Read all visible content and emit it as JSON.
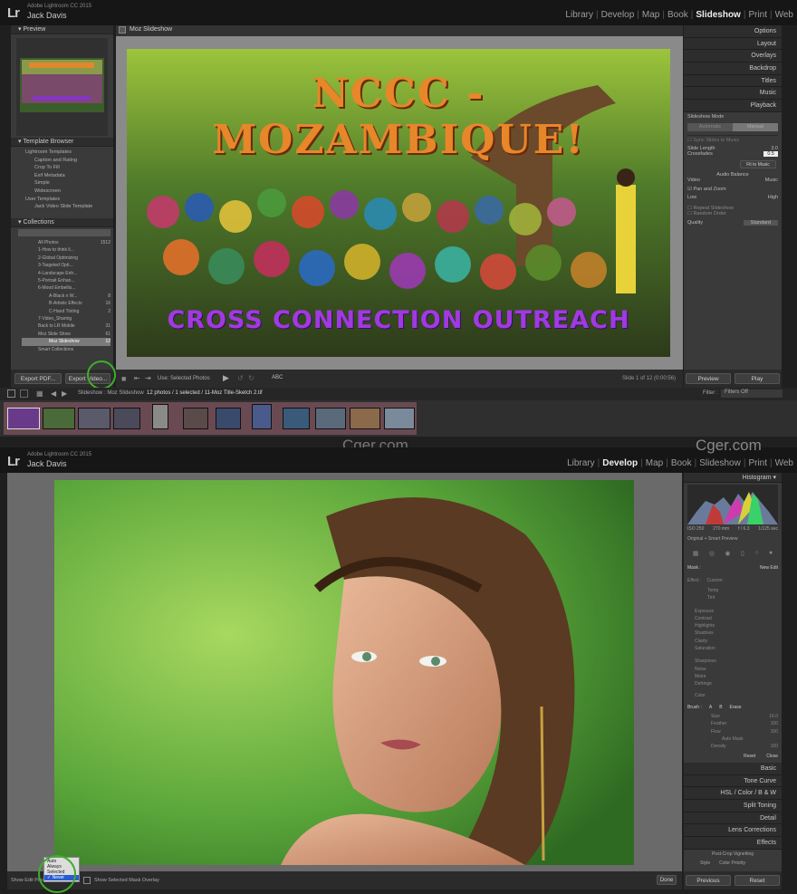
{
  "top": {
    "logo": "Lr",
    "product": "Adobe Lightroom CC 2015",
    "user": "Jack Davis",
    "modules": [
      "Library",
      "Develop",
      "Map",
      "Book",
      "Slideshow",
      "Print",
      "Web"
    ],
    "active": "Slideshow"
  },
  "left": {
    "preview_label": "Preview",
    "template_browser": "Template Browser",
    "templates": [
      "Lightroom Templates",
      "Caption and Rating",
      "Crop To Fill",
      "Exif Metadata",
      "Simple",
      "Widescreen",
      "User Templates",
      "Jack Video Slide Template"
    ],
    "collections_label": "Collections",
    "collections": [
      {
        "name": "All Photos",
        "count": "1512"
      },
      {
        "name": "1-How to think li...",
        "count": ""
      },
      {
        "name": "2-Global Optimizing",
        "count": ""
      },
      {
        "name": "3-Targeted Opti...",
        "count": ""
      },
      {
        "name": "4-Landscape Enh...",
        "count": ""
      },
      {
        "name": "5-Portrait Enhan...",
        "count": ""
      },
      {
        "name": "6-Mood Embellis...",
        "count": ""
      },
      {
        "name": "A-Black n W...",
        "count": "8"
      },
      {
        "name": "B-Artistic Effects",
        "count": "16"
      },
      {
        "name": "C-Hand Tinting",
        "count": "2"
      },
      {
        "name": "7-Video_Sharing",
        "count": ""
      },
      {
        "name": "Back to LR Mobile",
        "count": "31"
      },
      {
        "name": "Moz Slide Show",
        "count": "61"
      },
      {
        "name": "Moz Slideshow",
        "count": "12"
      },
      {
        "name": "Smart Collections",
        "count": ""
      }
    ],
    "export_pdf": "Export PDF...",
    "export_video": "Export Video..."
  },
  "center": {
    "title": "Moz Slideshow",
    "slide_title": "NCCC - MOZAMBIQUE!",
    "slide_subtitle": "CROSS CONNECTION OUTREACH",
    "use_label": "Use:",
    "use_value": "Selected Photos",
    "abc": "ABC",
    "slide_counter": "Slide 1 of 12 (0:00:56)"
  },
  "right": {
    "sections": [
      "Options",
      "Layout",
      "Overlays",
      "Backdrop",
      "Titles",
      "Music",
      "Playback"
    ],
    "slideshow_mode": "Slideshow Mode",
    "mode_automatic": "Automatic",
    "mode_manual": "Manual",
    "sync_music": "Sync Slides to Music",
    "slide_length": "Slide Length",
    "crossfades": "Crossfades",
    "slide_length_val": "3.0",
    "crossfades_val": "0.5",
    "fit_to_music": "Fit to Music",
    "audio_balance": "Audio Balance",
    "video": "Video",
    "music": "Music",
    "pan_zoom": "Pan and Zoom",
    "low": "Low",
    "high": "High",
    "repeat": "Repeat Slideshow",
    "random": "Random Order",
    "quality": "Quality",
    "quality_val": "Standard",
    "preview_btn": "Preview",
    "play_btn": "Play"
  },
  "filmstrip": {
    "path": "Slideshow : Moz Slideshow",
    "count": "12 photos / 1 selected / 11-Moz Title-Sketch 2.tif",
    "filter_label": "Filter :",
    "filter_value": "Filters Off"
  },
  "watermark": "Cger.com",
  "bottom": {
    "active": "Develop",
    "histogram": "Histogram",
    "hist_info": [
      "ISO 250",
      "270 mm",
      "f / 6.3",
      "1/125 sec"
    ],
    "original": "Original + Smart Preview",
    "mask": "Mask :",
    "mask_new": "New",
    "mask_edit": "Edit",
    "effect": "Effect :",
    "effect_val": "Custom",
    "sliders": [
      "Temp",
      "Tint",
      "Exposure",
      "Contrast",
      "Highlights",
      "Shadows",
      "Clarity",
      "Saturation",
      "Sharpness",
      "Noise",
      "Moire",
      "Defringe",
      "Color"
    ],
    "brush": "Brush :",
    "brush_a": "A",
    "brush_b": "B",
    "brush_erase": "Erase",
    "brush_rows": [
      "Size",
      "Feather",
      "Flow",
      "Density"
    ],
    "brush_vals": [
      "16.0",
      "100",
      "100",
      "100"
    ],
    "auto_mask": "Auto Mask",
    "reset": "Reset",
    "close": "Close",
    "panels": [
      "Basic",
      "Tone Curve",
      "HSL / Color / B & W",
      "Split Toning",
      "Detail",
      "Lens Corrections",
      "Effects"
    ],
    "post_crop": "Post-Crop Vignetting",
    "style": "Style",
    "style_val": "Color Priority",
    "show_edit_pins": "Show Edit Pins :",
    "pins_options": [
      "Auto",
      "Always",
      "Selected",
      "Never"
    ],
    "pins_selected": "Never",
    "show_mask_overlay": "Show Selected Mask Overlay",
    "done": "Done",
    "previous": "Previous",
    "reset_btn": "Reset"
  },
  "colors": {
    "accent": "#3fae2a",
    "slide_title": "#e8862a",
    "slide_subtitle": "#8a2fd6",
    "panel": "#3a3a3a"
  }
}
